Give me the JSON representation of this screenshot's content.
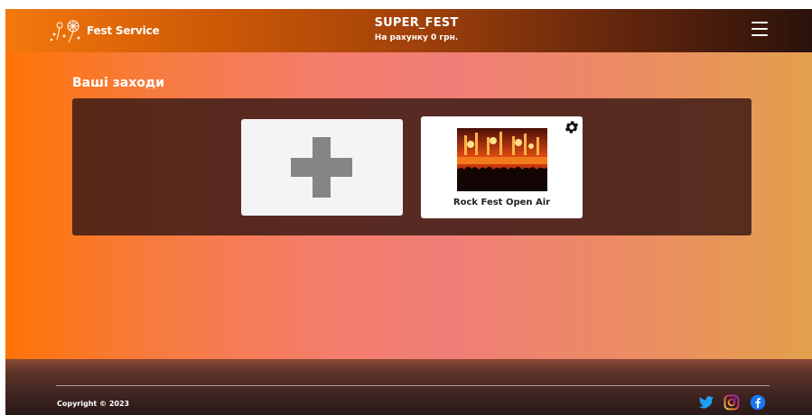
{
  "header": {
    "logo_text": "Fest Service",
    "title": "SUPER_FEST",
    "balance": "На рахунку 0 грн.",
    "menu_icon": "hamburger-menu-icon"
  },
  "main": {
    "section_title": "Ваші заходи",
    "add_card_icon": "plus-icon",
    "events": [
      {
        "name": "Rock Fest Open Air",
        "settings_icon": "gear-icon"
      }
    ]
  },
  "footer": {
    "copyright": "Copyright © 2023",
    "social_icons": [
      "twitter-icon",
      "instagram-icon",
      "facebook-icon"
    ]
  },
  "colors": {
    "text_light": "#ffffff",
    "panel_dark": "#3e1c16",
    "card_bg": "#f4f4f6",
    "plus_gray": "#858585",
    "twitter": "#1da1f2",
    "instagram": "#c13584",
    "facebook": "#1877f2"
  }
}
